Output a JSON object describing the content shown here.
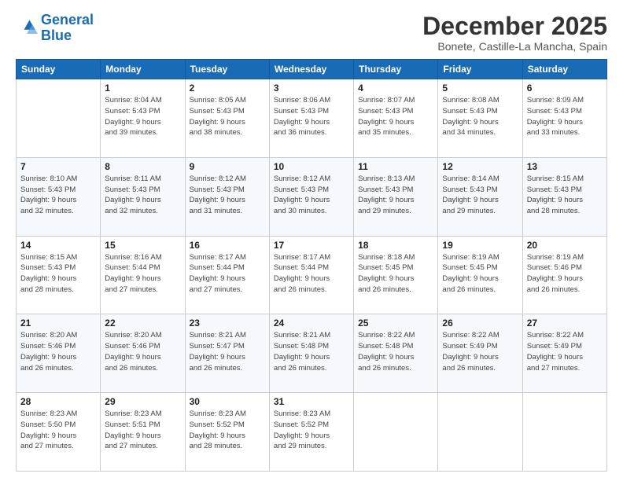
{
  "header": {
    "logo_line1": "General",
    "logo_line2": "Blue",
    "title": "December 2025",
    "subtitle": "Bonete, Castille-La Mancha, Spain"
  },
  "calendar": {
    "columns": [
      "Sunday",
      "Monday",
      "Tuesday",
      "Wednesday",
      "Thursday",
      "Friday",
      "Saturday"
    ],
    "weeks": [
      [
        {
          "day": "",
          "info": ""
        },
        {
          "day": "1",
          "info": "Sunrise: 8:04 AM\nSunset: 5:43 PM\nDaylight: 9 hours\nand 39 minutes."
        },
        {
          "day": "2",
          "info": "Sunrise: 8:05 AM\nSunset: 5:43 PM\nDaylight: 9 hours\nand 38 minutes."
        },
        {
          "day": "3",
          "info": "Sunrise: 8:06 AM\nSunset: 5:43 PM\nDaylight: 9 hours\nand 36 minutes."
        },
        {
          "day": "4",
          "info": "Sunrise: 8:07 AM\nSunset: 5:43 PM\nDaylight: 9 hours\nand 35 minutes."
        },
        {
          "day": "5",
          "info": "Sunrise: 8:08 AM\nSunset: 5:43 PM\nDaylight: 9 hours\nand 34 minutes."
        },
        {
          "day": "6",
          "info": "Sunrise: 8:09 AM\nSunset: 5:43 PM\nDaylight: 9 hours\nand 33 minutes."
        }
      ],
      [
        {
          "day": "7",
          "info": "Sunrise: 8:10 AM\nSunset: 5:43 PM\nDaylight: 9 hours\nand 32 minutes."
        },
        {
          "day": "8",
          "info": "Sunrise: 8:11 AM\nSunset: 5:43 PM\nDaylight: 9 hours\nand 32 minutes."
        },
        {
          "day": "9",
          "info": "Sunrise: 8:12 AM\nSunset: 5:43 PM\nDaylight: 9 hours\nand 31 minutes."
        },
        {
          "day": "10",
          "info": "Sunrise: 8:12 AM\nSunset: 5:43 PM\nDaylight: 9 hours\nand 30 minutes."
        },
        {
          "day": "11",
          "info": "Sunrise: 8:13 AM\nSunset: 5:43 PM\nDaylight: 9 hours\nand 29 minutes."
        },
        {
          "day": "12",
          "info": "Sunrise: 8:14 AM\nSunset: 5:43 PM\nDaylight: 9 hours\nand 29 minutes."
        },
        {
          "day": "13",
          "info": "Sunrise: 8:15 AM\nSunset: 5:43 PM\nDaylight: 9 hours\nand 28 minutes."
        }
      ],
      [
        {
          "day": "14",
          "info": "Sunrise: 8:15 AM\nSunset: 5:43 PM\nDaylight: 9 hours\nand 28 minutes."
        },
        {
          "day": "15",
          "info": "Sunrise: 8:16 AM\nSunset: 5:44 PM\nDaylight: 9 hours\nand 27 minutes."
        },
        {
          "day": "16",
          "info": "Sunrise: 8:17 AM\nSunset: 5:44 PM\nDaylight: 9 hours\nand 27 minutes."
        },
        {
          "day": "17",
          "info": "Sunrise: 8:17 AM\nSunset: 5:44 PM\nDaylight: 9 hours\nand 26 minutes."
        },
        {
          "day": "18",
          "info": "Sunrise: 8:18 AM\nSunset: 5:45 PM\nDaylight: 9 hours\nand 26 minutes."
        },
        {
          "day": "19",
          "info": "Sunrise: 8:19 AM\nSunset: 5:45 PM\nDaylight: 9 hours\nand 26 minutes."
        },
        {
          "day": "20",
          "info": "Sunrise: 8:19 AM\nSunset: 5:46 PM\nDaylight: 9 hours\nand 26 minutes."
        }
      ],
      [
        {
          "day": "21",
          "info": "Sunrise: 8:20 AM\nSunset: 5:46 PM\nDaylight: 9 hours\nand 26 minutes."
        },
        {
          "day": "22",
          "info": "Sunrise: 8:20 AM\nSunset: 5:46 PM\nDaylight: 9 hours\nand 26 minutes."
        },
        {
          "day": "23",
          "info": "Sunrise: 8:21 AM\nSunset: 5:47 PM\nDaylight: 9 hours\nand 26 minutes."
        },
        {
          "day": "24",
          "info": "Sunrise: 8:21 AM\nSunset: 5:48 PM\nDaylight: 9 hours\nand 26 minutes."
        },
        {
          "day": "25",
          "info": "Sunrise: 8:22 AM\nSunset: 5:48 PM\nDaylight: 9 hours\nand 26 minutes."
        },
        {
          "day": "26",
          "info": "Sunrise: 8:22 AM\nSunset: 5:49 PM\nDaylight: 9 hours\nand 26 minutes."
        },
        {
          "day": "27",
          "info": "Sunrise: 8:22 AM\nSunset: 5:49 PM\nDaylight: 9 hours\nand 27 minutes."
        }
      ],
      [
        {
          "day": "28",
          "info": "Sunrise: 8:23 AM\nSunset: 5:50 PM\nDaylight: 9 hours\nand 27 minutes."
        },
        {
          "day": "29",
          "info": "Sunrise: 8:23 AM\nSunset: 5:51 PM\nDaylight: 9 hours\nand 27 minutes."
        },
        {
          "day": "30",
          "info": "Sunrise: 8:23 AM\nSunset: 5:52 PM\nDaylight: 9 hours\nand 28 minutes."
        },
        {
          "day": "31",
          "info": "Sunrise: 8:23 AM\nSunset: 5:52 PM\nDaylight: 9 hours\nand 29 minutes."
        },
        {
          "day": "",
          "info": ""
        },
        {
          "day": "",
          "info": ""
        },
        {
          "day": "",
          "info": ""
        }
      ]
    ]
  }
}
